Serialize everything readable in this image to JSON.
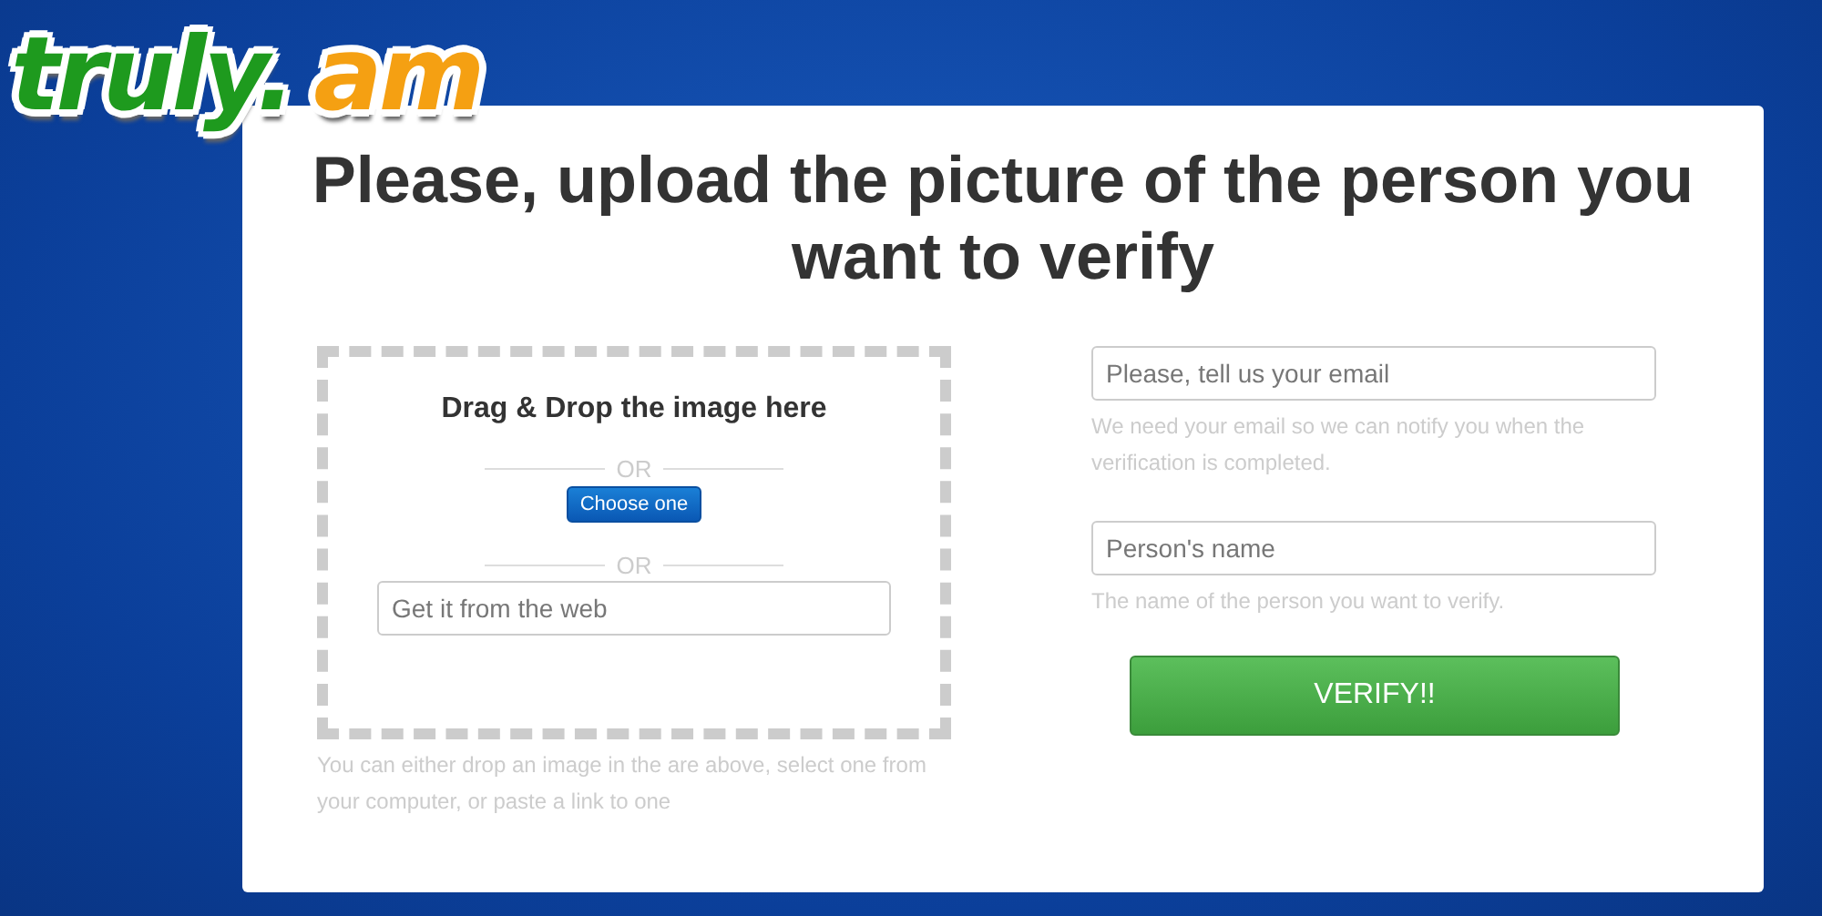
{
  "logo": {
    "parts": [
      "truly.",
      "am"
    ]
  },
  "title": "Please, upload the picture of the person you want to verify",
  "dropzone": {
    "heading": "Drag & Drop the image here",
    "separators": [
      "OR",
      "OR"
    ],
    "choose_button": "Choose one",
    "url_field": {
      "placeholder": "Get it from the web"
    },
    "help": "You can either drop an image in the are above, select one from your computer, or paste a link to one"
  },
  "form": {
    "fields": [
      {
        "placeholder": "Please, tell us your email",
        "help": "We need your email so we can notify you when the verification is completed."
      },
      {
        "placeholder": "Person's name",
        "help": "The name of the person you want to verify."
      }
    ],
    "submit": "VERIFY!!"
  }
}
